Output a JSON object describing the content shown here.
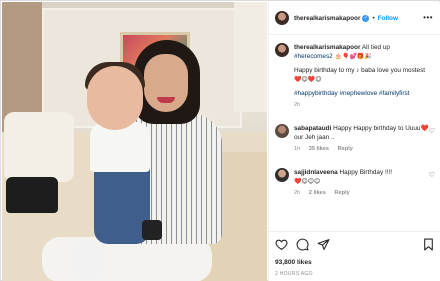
{
  "post": {
    "username": "therealkarismakapoor",
    "follow_label": "Follow",
    "separator": "•",
    "more_label": "•••"
  },
  "caption": {
    "username": "therealkarismakapoor",
    "line1": "All tied up",
    "hashtag1": "#herecomes2",
    "emoji1": "🎂🎈💕🎁🎉",
    "line2": "Happy birthday to my ♪ baba love you mostest",
    "emoji2": "❤️😊❤️😊",
    "hashtags": "#happybirthday #nephewlove #familyfirst",
    "time": "2h"
  },
  "comments": [
    {
      "username": "sabapataudi",
      "text": "Happy Happy birthday to Uuuu❤️ our Jeh jaan ..",
      "time": "1h",
      "likes": "35 likes",
      "reply": "Reply"
    },
    {
      "username": "sajjidnlaveena",
      "text": "Happy Birthday !!!!",
      "emoji": "❤️😊😊😊",
      "time": "2h",
      "likes": "2 likes",
      "reply": "Reply"
    }
  ],
  "actions": {
    "likes": "93,800 likes",
    "timestamp": "2 HOURS AGO"
  },
  "colors": {
    "link": "#0095f6",
    "hashtag": "#00376b",
    "muted": "#8e8e8e"
  },
  "icons": [
    "heart-icon",
    "comment-icon",
    "share-icon",
    "bookmark-icon",
    "more-icon",
    "verified-badge-icon"
  ]
}
